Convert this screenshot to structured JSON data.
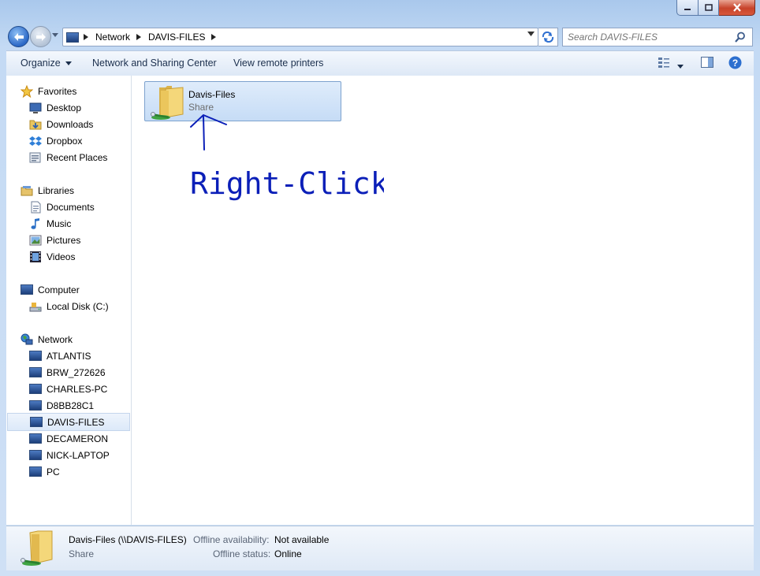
{
  "window": {
    "controls": {
      "minimize_icon": "minimize-icon",
      "maximize_icon": "maximize-icon",
      "close_icon": "close-icon"
    }
  },
  "address": {
    "segments": [
      "Network",
      "DAVIS-FILES"
    ],
    "search_placeholder": "Search DAVIS-FILES"
  },
  "toolbar": {
    "organize": "Organize",
    "network_sharing": "Network and Sharing Center",
    "remote_printers": "View remote printers"
  },
  "sidebar": {
    "favorites": {
      "label": "Favorites",
      "items": [
        "Desktop",
        "Downloads",
        "Dropbox",
        "Recent Places"
      ]
    },
    "libraries": {
      "label": "Libraries",
      "items": [
        "Documents",
        "Music",
        "Pictures",
        "Videos"
      ]
    },
    "computer": {
      "label": "Computer",
      "items": [
        "Local Disk (C:)"
      ]
    },
    "network": {
      "label": "Network",
      "items": [
        "ATLANTIS",
        "BRW_272626",
        "CHARLES-PC",
        "D8BB28C1",
        "DAVIS-FILES",
        "DECAMERON",
        "NICK-LAPTOP",
        "PC"
      ],
      "selected": "DAVIS-FILES"
    }
  },
  "content": {
    "item": {
      "name": "Davis-Files",
      "type": "Share"
    },
    "annotation": "Right-Click"
  },
  "details": {
    "title": "Davis-Files (\\\\DAVIS-FILES)",
    "type": "Share",
    "availability_label": "Offline availability:",
    "availability_value": "Not available",
    "status_label": "Offline status:",
    "status_value": "Online"
  },
  "colors": {
    "selection": "#cde0f7",
    "ink": "#0b1fb8",
    "window_frame": "#bcd4f1"
  }
}
